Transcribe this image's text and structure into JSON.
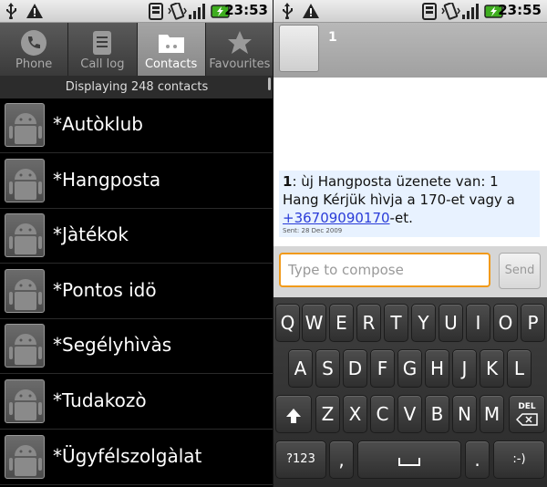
{
  "status_bar": {
    "time_left": "23:53",
    "time_right": "23:55"
  },
  "tabs": [
    {
      "label": "Phone",
      "icon": "phone-icon"
    },
    {
      "label": "Call log",
      "icon": "call-log-icon"
    },
    {
      "label": "Contacts",
      "icon": "contacts-folder-icon",
      "active": true
    },
    {
      "label": "Favourites",
      "icon": "star-icon"
    }
  ],
  "contacts": {
    "count_text": "Displaying 248 contacts",
    "items": [
      "*Autòklub",
      "*Hangposta",
      "*Jàtékok",
      "*Pontos idö",
      "*Segélyhìvàs",
      "*Tudakozò",
      "*Ügyfélszolgàlat"
    ]
  },
  "conversation": {
    "title": "1",
    "message": {
      "sender": "1",
      "text_pre": ": ùj Hangposta üzenete van: 1 Hang Kérjük hìvja a 170-et vagy a ",
      "link": "+36709090170",
      "text_post": "-et.",
      "date": "Sent: 28 Dec 2009"
    },
    "compose_placeholder": "Type to compose",
    "send_label": "Send"
  },
  "keyboard": {
    "row1": [
      "Q",
      "W",
      "E",
      "R",
      "T",
      "Y",
      "U",
      "I",
      "O",
      "P"
    ],
    "row2": [
      "A",
      "S",
      "D",
      "F",
      "G",
      "H",
      "J",
      "K",
      "L"
    ],
    "row3": [
      "Z",
      "X",
      "C",
      "V",
      "B",
      "N",
      "M"
    ],
    "del_label": "DEL",
    "sym_label": "?123",
    "comma_label": ",",
    "period_label": ".",
    "smiley_label": ":-)"
  },
  "colors": {
    "accent_orange": "#f19a1a",
    "link_blue": "#2a3cd8",
    "battery_green": "#3fae1f"
  }
}
